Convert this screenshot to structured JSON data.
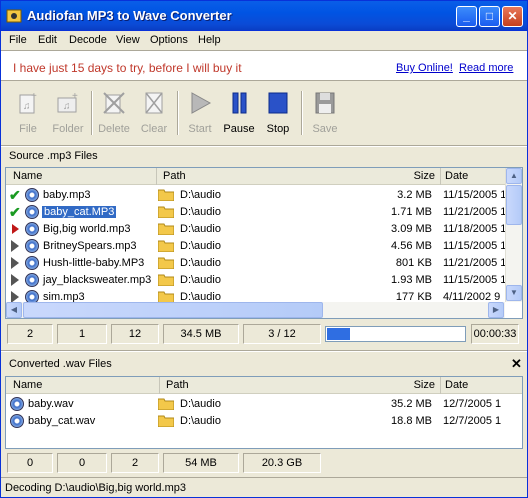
{
  "window": {
    "title": "Audiofan MP3 to Wave Converter"
  },
  "menu": [
    "File",
    "Edit",
    "Decode",
    "View",
    "Options",
    "Help"
  ],
  "notice": {
    "text": "I have just 15 days to try, before I will buy it",
    "buy_link": "Buy Online!",
    "more_link": "Read more"
  },
  "toolbar": [
    {
      "label": "File",
      "icon": "add-file-icon",
      "enabled": false
    },
    {
      "label": "Folder",
      "icon": "add-folder-icon",
      "enabled": false
    },
    {
      "label": "Delete",
      "icon": "delete-icon",
      "enabled": false
    },
    {
      "label": "Clear",
      "icon": "clear-icon",
      "enabled": false
    },
    {
      "label": "Start",
      "icon": "play-icon",
      "enabled": false
    },
    {
      "label": "Pause",
      "icon": "pause-icon",
      "enabled": true
    },
    {
      "label": "Stop",
      "icon": "stop-icon",
      "enabled": true
    },
    {
      "label": "Save",
      "icon": "save-icon",
      "enabled": false
    }
  ],
  "source": {
    "label": "Source .mp3 Files",
    "columns": [
      "Name",
      "Path",
      "Size",
      "Date"
    ],
    "rows": [
      {
        "name": "baby.mp3",
        "path": "D:\\audio",
        "size": "3.2 MB",
        "date": "11/15/2005 1",
        "status": "done"
      },
      {
        "name": "baby_cat.MP3",
        "path": "D:\\audio",
        "size": "1.71 MB",
        "date": "11/21/2005 1",
        "status": "done",
        "selected": true
      },
      {
        "name": "Big,big world.mp3",
        "path": "D:\\audio",
        "size": "3.09 MB",
        "date": "11/18/2005 1",
        "status": "playing"
      },
      {
        "name": "BritneySpears.mp3",
        "path": "D:\\audio",
        "size": "4.56 MB",
        "date": "11/15/2005 1",
        "status": "pending"
      },
      {
        "name": "Hush-little-baby.MP3",
        "path": "D:\\audio",
        "size": "801 KB",
        "date": "11/21/2005 1",
        "status": "pending"
      },
      {
        "name": "jay_blacksweater.mp3",
        "path": "D:\\audio",
        "size": "1.93 MB",
        "date": "11/15/2005 1",
        "status": "pending"
      },
      {
        "name": "sim.mp3",
        "path": "D:\\audio",
        "size": "177 KB",
        "date": "4/11/2002 9",
        "status": "pending"
      }
    ],
    "stats": [
      "2",
      "1",
      "12",
      "34.5 MB",
      "3 / 12"
    ],
    "progress": 0.17,
    "elapsed": "00:00:33"
  },
  "converted": {
    "label": "Converted .wav Files",
    "columns": [
      "Name",
      "Path",
      "Size",
      "Date"
    ],
    "rows": [
      {
        "name": "baby.wav",
        "path": "D:\\audio",
        "size": "35.2 MB",
        "date": "12/7/2005 1"
      },
      {
        "name": "baby_cat.wav",
        "path": "D:\\audio",
        "size": "18.8 MB",
        "date": "12/7/2005 1"
      }
    ],
    "stats": [
      "0",
      "0",
      "2",
      "54 MB",
      "20.3 GB"
    ]
  },
  "status_bar": "Decoding D:\\audio\\Big,big world.mp3",
  "colors": {
    "title_bar": "#0054e3",
    "notice_text": "#c0382b",
    "link": "#0000cc",
    "selection": "#316ac5",
    "progress_fill": "#2f6ee2"
  }
}
